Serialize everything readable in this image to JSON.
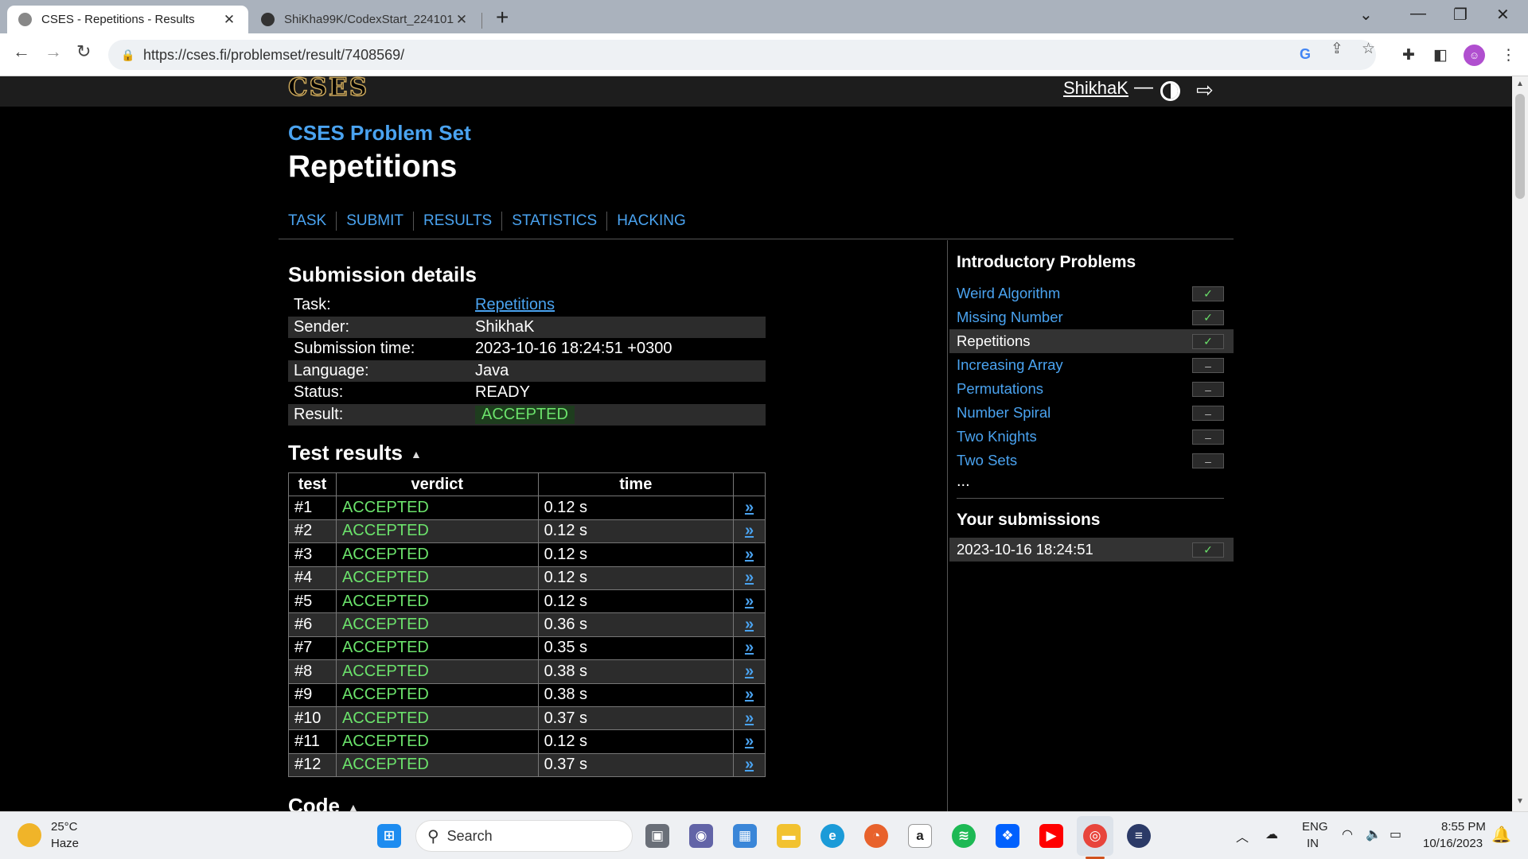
{
  "browser": {
    "tabs": [
      {
        "title": "CSES - Repetitions - Results",
        "close": "✕"
      },
      {
        "title": "ShiKha99K/CodexStart_2241011…",
        "close": "✕"
      }
    ],
    "new_tab": "+",
    "url": "https://cses.fi/problemset/result/7408569/",
    "window_controls": {
      "dropdown": "⌄",
      "minimize": "—",
      "restore": "❐",
      "close": "✕"
    }
  },
  "site": {
    "user": "ShikhaK",
    "user_dash": "—",
    "site_title": "CSES Problem Set",
    "logo_text": "CSES",
    "page_title": "Repetitions",
    "nav": [
      "TASK",
      "SUBMIT",
      "RESULTS",
      "STATISTICS",
      "HACKING"
    ]
  },
  "submission": {
    "heading": "Submission details",
    "rows": [
      {
        "label": "Task:",
        "value": "Repetitions"
      },
      {
        "label": "Sender:",
        "value": "ShikhaK"
      },
      {
        "label": "Submission time:",
        "value": "2023-10-16 18:24:51 +0300"
      },
      {
        "label": "Language:",
        "value": "Java"
      },
      {
        "label": "Status:",
        "value": "READY"
      },
      {
        "label": "Result:",
        "value": "ACCEPTED"
      }
    ]
  },
  "tests": {
    "heading": "Test results",
    "caret": "▲",
    "columns": [
      "test",
      "verdict",
      "time",
      ""
    ],
    "rows": [
      {
        "test": "#1",
        "verdict": "ACCEPTED",
        "time": "0.12 s"
      },
      {
        "test": "#2",
        "verdict": "ACCEPTED",
        "time": "0.12 s"
      },
      {
        "test": "#3",
        "verdict": "ACCEPTED",
        "time": "0.12 s"
      },
      {
        "test": "#4",
        "verdict": "ACCEPTED",
        "time": "0.12 s"
      },
      {
        "test": "#5",
        "verdict": "ACCEPTED",
        "time": "0.12 s"
      },
      {
        "test": "#6",
        "verdict": "ACCEPTED",
        "time": "0.36 s"
      },
      {
        "test": "#7",
        "verdict": "ACCEPTED",
        "time": "0.35 s"
      },
      {
        "test": "#8",
        "verdict": "ACCEPTED",
        "time": "0.38 s"
      },
      {
        "test": "#9",
        "verdict": "ACCEPTED",
        "time": "0.38 s"
      },
      {
        "test": "#10",
        "verdict": "ACCEPTED",
        "time": "0.37 s"
      },
      {
        "test": "#11",
        "verdict": "ACCEPTED",
        "time": "0.12 s"
      },
      {
        "test": "#12",
        "verdict": "ACCEPTED",
        "time": "0.37 s"
      }
    ],
    "go_symbol": "»"
  },
  "code": {
    "heading": "Code",
    "caret": "▲"
  },
  "sidebar": {
    "heading": "Introductory Problems",
    "problems": [
      {
        "name": "Weird Algorithm",
        "status": "done"
      },
      {
        "name": "Missing Number",
        "status": "done"
      },
      {
        "name": "Repetitions",
        "status": "done",
        "current": true
      },
      {
        "name": "Increasing Array",
        "status": "todo"
      },
      {
        "name": "Permutations",
        "status": "todo"
      },
      {
        "name": "Number Spiral",
        "status": "todo"
      },
      {
        "name": "Two Knights",
        "status": "todo"
      },
      {
        "name": "Two Sets",
        "status": "todo"
      }
    ],
    "more": "...",
    "check_symbol": "✓",
    "dash_symbol": "–",
    "submissions_heading": "Your submissions",
    "submissions": [
      {
        "time": "2023-10-16 18:24:51",
        "status": "done"
      }
    ]
  },
  "taskbar": {
    "weather_temp": "25°C",
    "weather_desc": "Haze",
    "search_placeholder": "Search",
    "lang_line1": "ENG",
    "lang_line2": "IN",
    "time": "8:55 PM",
    "date": "10/16/2023"
  },
  "colors": {
    "link": "#4aa3f0",
    "accepted": "#6be26b",
    "page_bg": "#000000"
  }
}
